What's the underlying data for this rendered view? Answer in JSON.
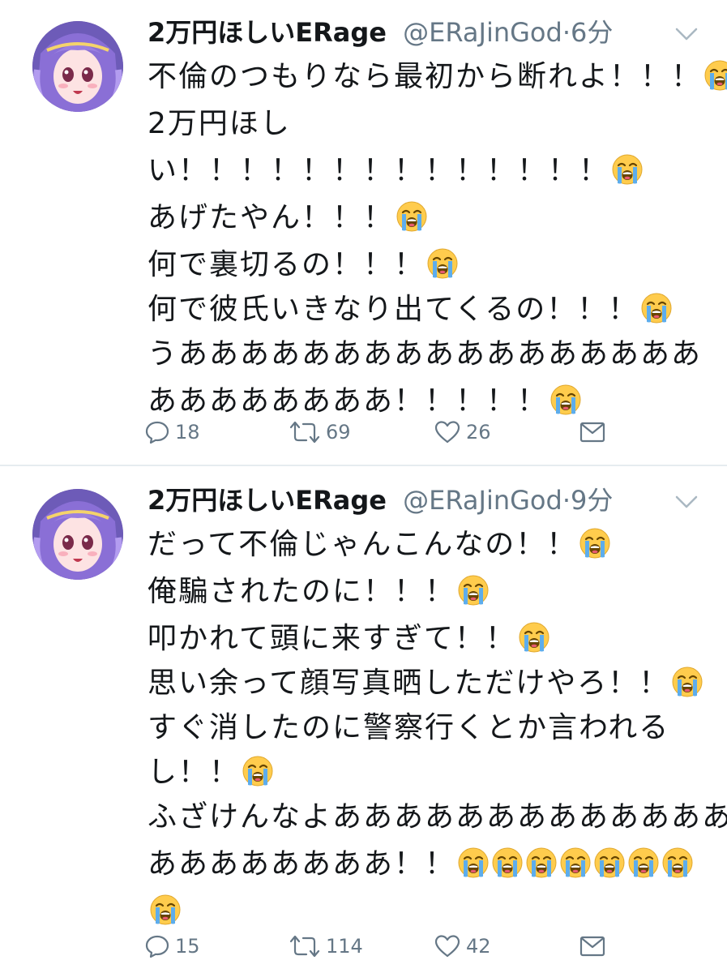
{
  "colors": {
    "text": "#14171a",
    "secondary": "#657786",
    "divider": "#e6ecf0"
  },
  "tweets": [
    {
      "display_name": "2万円ほしいERage",
      "handle": "@ERaJinGod",
      "separator": "·",
      "time": "6分",
      "lines": [
        {
          "text": "不倫のつもりなら最初から断れよ！！！",
          "emoji_count": 1
        },
        {
          "text": "2万円ほし",
          "emoji_count": 0
        },
        {
          "text": "い！！！！！！！！！！！！！！",
          "emoji_count": 1
        },
        {
          "text": "あげたやん！！！",
          "emoji_count": 1
        },
        {
          "text": "何で裏切るの！！！",
          "emoji_count": 1
        },
        {
          "text": "何で彼氏いきなり出てくるの！！！",
          "emoji_count": 1
        },
        {
          "text": "うあああああああああああああああああ",
          "emoji_count": 0
        },
        {
          "text": "ああああああああ！！！！！",
          "emoji_count": 1
        }
      ],
      "reply_count": "18",
      "retweet_count": "69",
      "like_count": "26",
      "icons": [
        "reply-icon",
        "retweet-icon",
        "like-icon",
        "dm-icon",
        "chevron-down-icon",
        "loudly-crying-face-emoji"
      ]
    },
    {
      "display_name": "2万円ほしいERage",
      "handle": "@ERaJinGod",
      "separator": "·",
      "time": "9分",
      "lines": [
        {
          "text": "だって不倫じゃんこんなの！！",
          "emoji_count": 1
        },
        {
          "text": "俺騙されたのに！！！",
          "emoji_count": 1
        },
        {
          "text": "叩かれて頭に来すぎて！！",
          "emoji_count": 1
        },
        {
          "text": "思い余って顔写真晒しただけやろ！！",
          "emoji_count": 1
        },
        {
          "text": "すぐ消したのに警察行くとか言われる",
          "emoji_count": 0
        },
        {
          "text": "し！！",
          "emoji_count": 1
        },
        {
          "text": "ふざけんなよあああああああああああああ",
          "emoji_count": 0
        },
        {
          "text": "ああああああああ！！",
          "emoji_count": 7
        },
        {
          "text": "",
          "emoji_count": 1
        }
      ],
      "reply_count": "15",
      "retweet_count": "114",
      "like_count": "42",
      "icons": [
        "reply-icon",
        "retweet-icon",
        "like-icon",
        "dm-icon",
        "chevron-down-icon",
        "loudly-crying-face-emoji"
      ]
    }
  ]
}
